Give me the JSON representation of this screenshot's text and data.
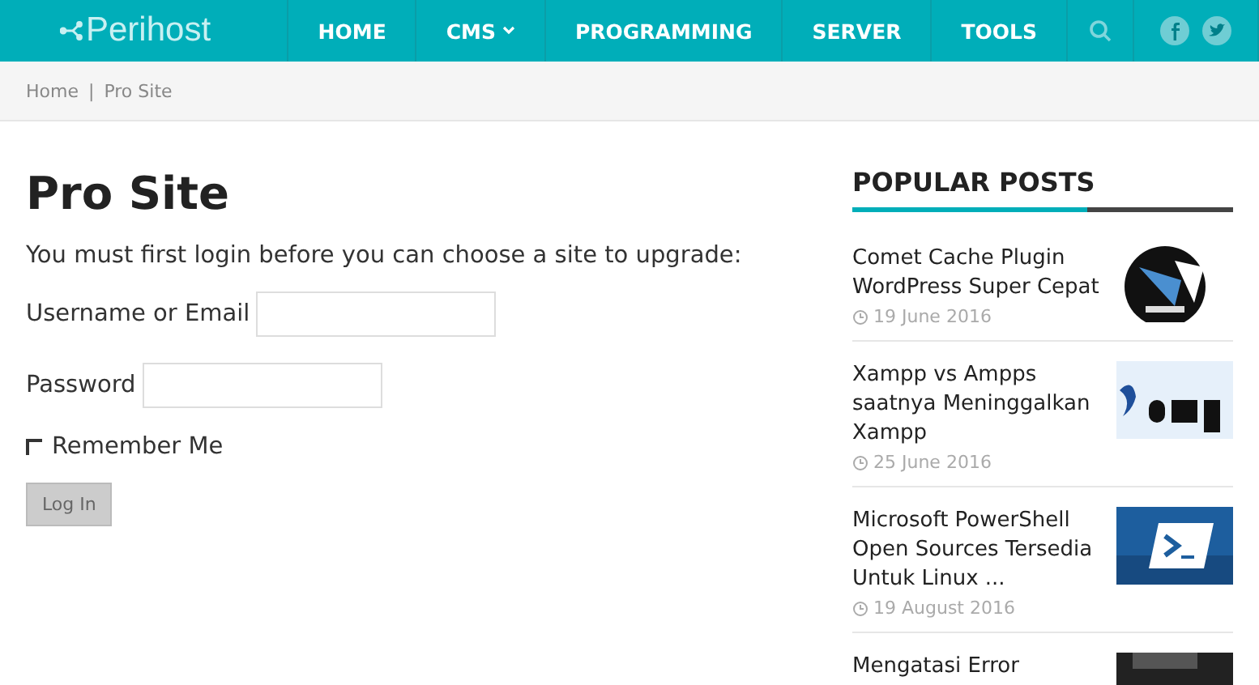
{
  "header": {
    "logo": "Perihost",
    "menu": [
      {
        "label": "HOME",
        "dropdown": false
      },
      {
        "label": "CMS",
        "dropdown": true
      },
      {
        "label": "PROGRAMMING",
        "dropdown": false
      },
      {
        "label": "SERVER",
        "dropdown": false
      },
      {
        "label": "TOOLS",
        "dropdown": false
      }
    ]
  },
  "breadcrumb": {
    "items": [
      "Home",
      "Pro Site"
    ],
    "separator": "|"
  },
  "page": {
    "title": "Pro Site",
    "intro": "You must first login before you can choose a site to upgrade:",
    "fields": [
      {
        "label": "Username or Email"
      },
      {
        "label": "Password"
      }
    ],
    "remember": {
      "label": "Remember Me",
      "checked": false
    },
    "button": "Log In"
  },
  "sidebar": {
    "title": "POPULAR POSTS",
    "posts": [
      {
        "title": "Comet Cache Plugin WordPress Super Cepat",
        "date": "19 June 2016"
      },
      {
        "title": "Xampp vs Ampps saatnya Meninggalkan Xampp",
        "date": "25 June 2016"
      },
      {
        "title": "Microsoft PowerShell Open Sources Tersedia Untuk Linux ...",
        "date": "19 August 2016"
      },
      {
        "title": "Mengatasi Error"
      }
    ]
  }
}
